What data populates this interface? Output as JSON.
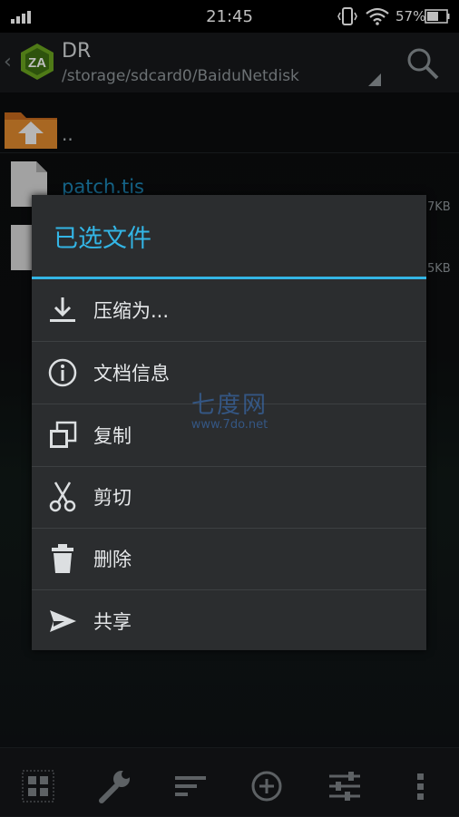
{
  "status_bar": {
    "time": "21:45",
    "battery_text": "57%",
    "icons": [
      "signal-icon",
      "vibrate-icon",
      "wifi-icon",
      "battery-icon"
    ]
  },
  "header": {
    "title": "DR",
    "path": "/storage/sdcard0/BaiduNetdisk",
    "icons": [
      "back-chevron-icon",
      "app-logo-icon",
      "dropdown-icon",
      "search-icon"
    ]
  },
  "file_list": {
    "parent_label": "..",
    "files": [
      {
        "name": "patch.tis",
        "size": "7KB"
      },
      {
        "name": "",
        "size": "5KB"
      }
    ]
  },
  "dialog": {
    "title": "已选文件",
    "items": [
      {
        "label": "压缩为...",
        "icon": "download-icon"
      },
      {
        "label": "文档信息",
        "icon": "info-icon"
      },
      {
        "label": "复制",
        "icon": "copy-icon"
      },
      {
        "label": "剪切",
        "icon": "scissors-icon"
      },
      {
        "label": "删除",
        "icon": "trash-icon"
      },
      {
        "label": "共享",
        "icon": "send-icon"
      }
    ]
  },
  "watermark": {
    "title": "七度网",
    "url": "www.7do.net"
  },
  "toolbar": {
    "icons": [
      "grid-select-icon",
      "wrench-icon",
      "sort-icon",
      "add-circle-icon",
      "sliders-icon",
      "overflow-menu-icon"
    ]
  },
  "colors": {
    "accent": "#33b5e5",
    "dialog_bg": "#2b2d2f",
    "file_name": "#1d86b6"
  }
}
